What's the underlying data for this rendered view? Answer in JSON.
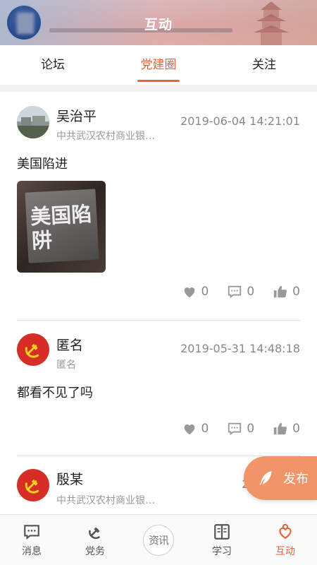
{
  "header": {
    "title": "互动"
  },
  "tabs": [
    {
      "label": "论坛"
    },
    {
      "label": "党建圈",
      "active": true
    },
    {
      "label": "关注"
    }
  ],
  "posts": [
    {
      "name": "吴治平",
      "org": "中共武汉农村商业银…",
      "time": "2019-06-04 14:21:01",
      "content": "美国陷进",
      "image_text": "美国陷阱",
      "likes": "0",
      "comments": "0",
      "thumbs": "0"
    },
    {
      "name": "匿名",
      "org": "匿名",
      "time": "2019-05-31 14:48:18",
      "content": "都看不见了吗",
      "likes": "0",
      "comments": "0",
      "thumbs": "0"
    },
    {
      "name": "殷某",
      "org": "中共武汉农村商业银…",
      "time": "2019-05-3"
    }
  ],
  "fab": {
    "label": "发布"
  },
  "nav": {
    "items": [
      {
        "label": "消息",
        "icon": "message-icon"
      },
      {
        "label": "党务",
        "icon": "party-emblem-icon"
      },
      {
        "label": "资讯",
        "icon": "news-logo-icon"
      },
      {
        "label": "学习",
        "icon": "book-icon"
      },
      {
        "label": "互动",
        "icon": "interaction-icon",
        "active": true
      }
    ]
  },
  "colors": {
    "accent": "#e5643a",
    "fab": "#f19568",
    "party_red": "#d62d26"
  }
}
